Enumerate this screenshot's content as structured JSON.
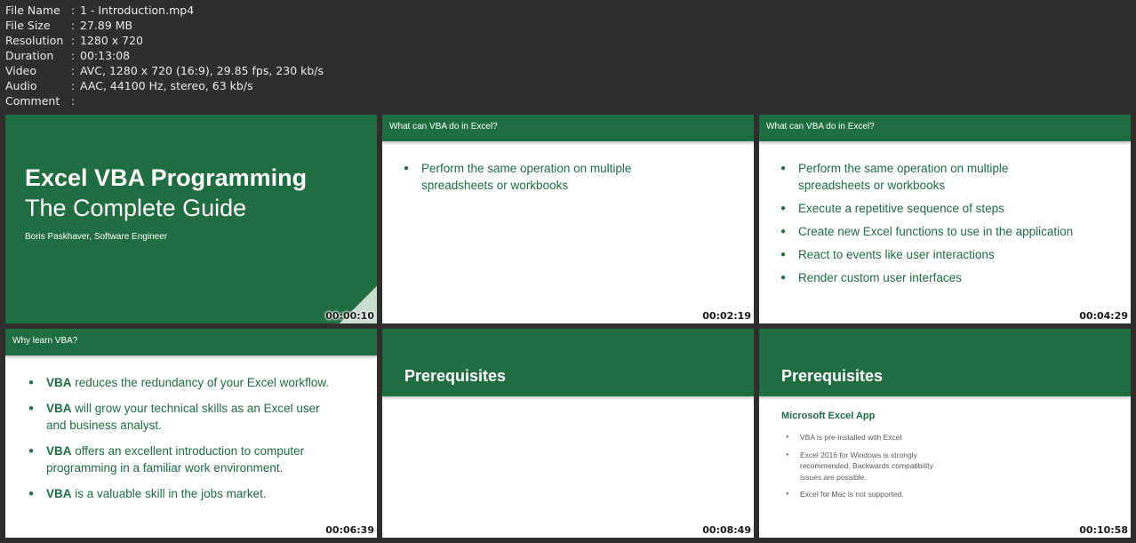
{
  "file_info": [
    {
      "key": "File Name",
      "value": "1 - Introduction.mp4"
    },
    {
      "key": "File Size",
      "value": "27.89 MB"
    },
    {
      "key": "Resolution",
      "value": "1280 x 720"
    },
    {
      "key": "Duration",
      "value": "00:13:08"
    },
    {
      "key": "Video",
      "value": "AVC, 1280 x 720 (16:9), 29.85 fps, 230 kb/s"
    },
    {
      "key": "Audio",
      "value": "AAC, 44100 Hz, stereo, 63 kb/s"
    },
    {
      "key": "Comment",
      "value": ""
    }
  ],
  "separator": ":",
  "thumbnails": {
    "t1": {
      "title_bold": "Excel VBA Programming",
      "title_sub": "The Complete Guide",
      "author": "Boris Paskhaver, Software Engineer",
      "timestamp": "00:00:10"
    },
    "t2": {
      "header": "What can VBA do in Excel?",
      "bullets": [
        "Perform the same operation on multiple spreadsheets or workbooks"
      ],
      "timestamp": "00:02:19"
    },
    "t3": {
      "header": "What can VBA do in Excel?",
      "bullets": [
        "Perform the same operation on multiple spreadsheets or workbooks",
        "Execute a repetitive sequence of steps",
        "Create new Excel functions to use in the application",
        "React to events like user interactions",
        "Render custom user interfaces"
      ],
      "timestamp": "00:04:29"
    },
    "t4": {
      "header": "Why learn VBA?",
      "keyword": "VBA",
      "bullets": [
        " reduces the redundancy of your Excel workflow.",
        " will grow your technical skills as an Excel user and business analyst.",
        " offers an excellent introduction to computer programming in a familiar work environment.",
        " is a valuable skill in the jobs market."
      ],
      "timestamp": "00:06:39"
    },
    "t5": {
      "title": "Prerequisites",
      "timestamp": "00:08:49"
    },
    "t6": {
      "title": "Prerequisites",
      "subheading": "Microsoft Excel App",
      "bullets": [
        "VBA is pre-installed with Excel",
        "Excel 2016 for Windows is strongly recommended. Backwards compatibility issues are possible.",
        "Excel for Mac is not supported."
      ],
      "timestamp": "00:10:58"
    }
  }
}
